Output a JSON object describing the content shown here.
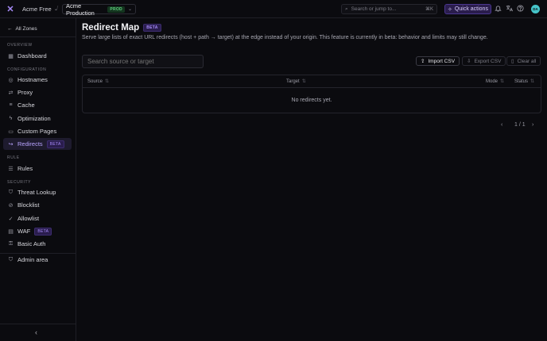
{
  "topbar": {
    "org_name": "Acme Free",
    "zone_name": "Acme Production",
    "zone_badge": "PROD",
    "search_placeholder": "Search or jump to...",
    "search_shortcut": "⌘K",
    "quick_actions_label": "Quick actions",
    "avatar_initials": "DA"
  },
  "sidebar": {
    "back_label": "All Zones",
    "sections": {
      "overview": "OVERVIEW",
      "configuration": "CONFIGURATION",
      "rule": "RULE",
      "security": "SECURITY"
    },
    "items": {
      "dashboard": "Dashboard",
      "hostnames": "Hostnames",
      "proxy": "Proxy",
      "cache": "Cache",
      "optimization": "Optimization",
      "custom_pages": "Custom Pages",
      "redirects": "Redirects",
      "rules": "Rules",
      "threat_lookup": "Threat Lookup",
      "blocklist": "Blocklist",
      "allowlist": "Allowlist",
      "waf": "WAF",
      "basic_auth": "Basic Auth",
      "admin_area": "Admin area"
    },
    "beta_badge": "BETA"
  },
  "page": {
    "title": "Redirect Map",
    "title_badge": "BETA",
    "subtitle": "Serve large lists of exact URL redirects (host + path → target) at the edge instead of your origin. This feature is currently in beta: behavior and limits may still change.",
    "search_placeholder": "Search source or target",
    "import_label": "Import CSV",
    "export_label": "Export CSV",
    "clear_label": "Clear all"
  },
  "table": {
    "columns": {
      "source": "Source",
      "target": "Target",
      "mode": "Mode",
      "status": "Status"
    },
    "empty_text": "No redirects yet."
  },
  "pagination": {
    "page_info": "1 / 1"
  },
  "colors": {
    "accent": "#a78bfa",
    "background": "#0b0b0f",
    "prod_badge": "#5fd17e"
  }
}
